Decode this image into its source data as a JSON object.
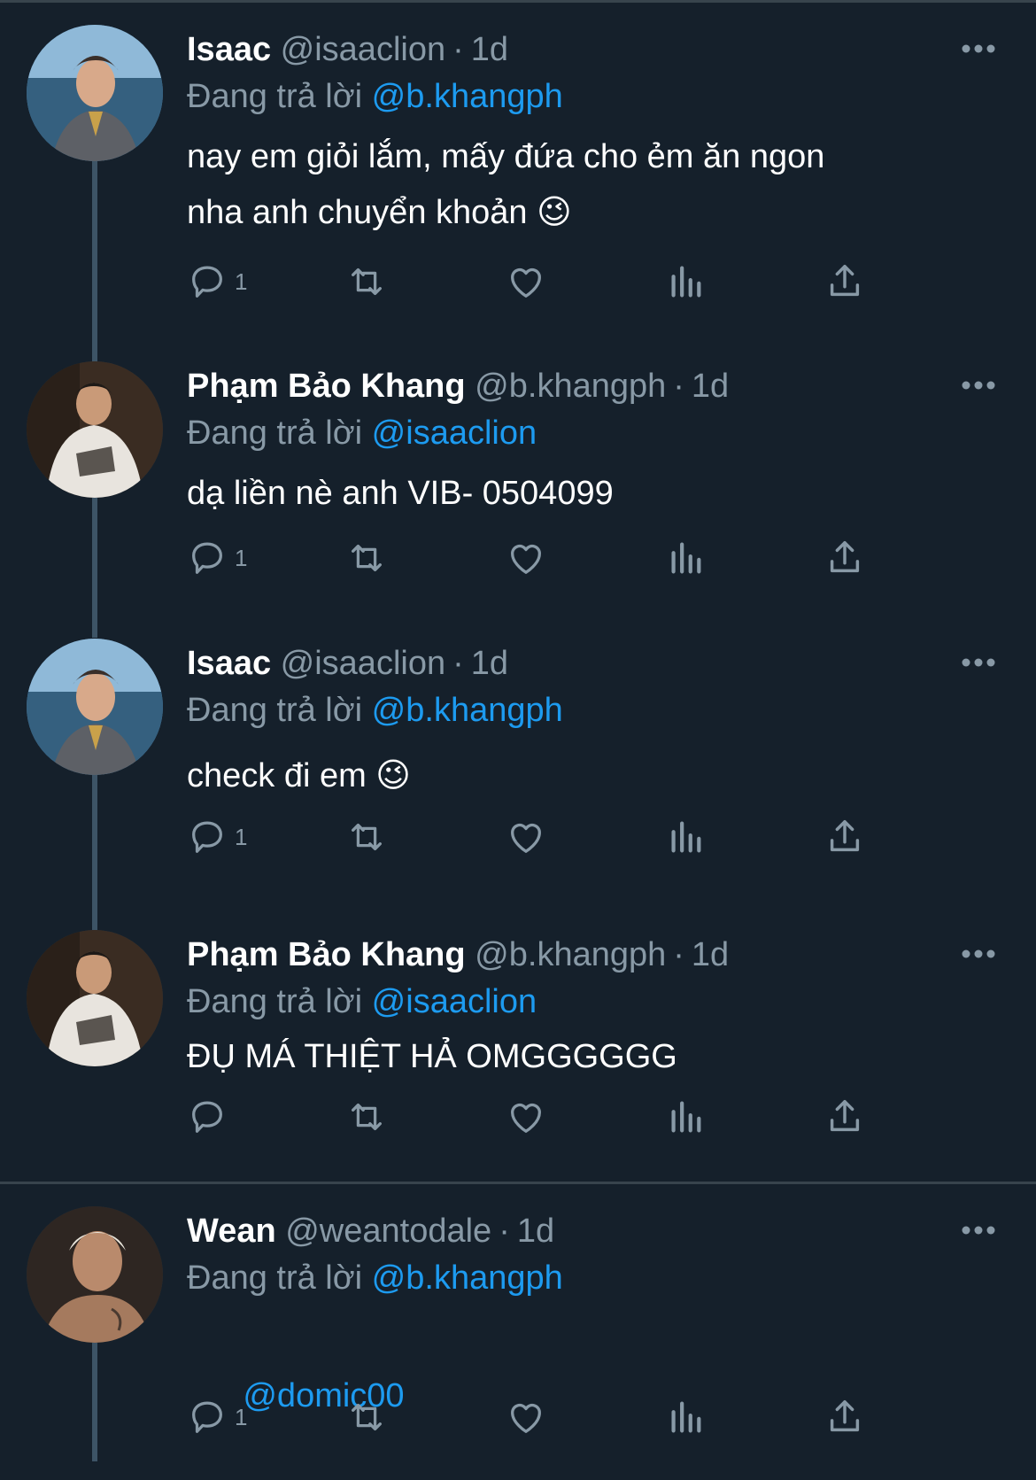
{
  "colors": {
    "background": "#15202b",
    "text": "#ffffff",
    "secondary": "#8899a6",
    "accent": "#1d9bf0",
    "thread_line": "#3d5466"
  },
  "tweets": [
    {
      "name": "Isaac",
      "handle": "@isaaclion",
      "dot": "·",
      "time": "1d",
      "reply_prefix": "Đang trả lời",
      "reply_to": "@b.khangph",
      "text": "nay em giỏi lắm, mấy đứa cho ẻm ăn ngon\nnha anh chuyển khoản 😉",
      "reply_count": "1"
    },
    {
      "name": "Phạm Bảo Khang",
      "handle": "@b.khangph",
      "dot": "·",
      "time": "1d",
      "reply_prefix": "Đang trả lời",
      "reply_to": "@isaaclion",
      "text": "dạ liền nè anh VIB- 0504099",
      "reply_count": "1"
    },
    {
      "name": "Isaac",
      "handle": "@isaaclion",
      "dot": "·",
      "time": "1d",
      "reply_prefix": "Đang trả lời",
      "reply_to": "@b.khangph",
      "text": "check đi em 😉",
      "reply_count": "1"
    },
    {
      "name": "Phạm Bảo Khang",
      "handle": "@b.khangph",
      "dot": "·",
      "time": "1d",
      "reply_prefix": "Đang trả lời",
      "reply_to": "@isaaclion",
      "text": "ĐỤ MÁ THIỆT HẢ OMGGGGGG",
      "reply_count": ""
    },
    {
      "name": "Wean",
      "handle": "@weantodale",
      "dot": "·",
      "time": "1d",
      "reply_prefix": "Đang trả lời",
      "reply_to": "@b.khangph",
      "text": "",
      "text_mention": "@domic00",
      "reply_count": "1"
    }
  ],
  "icons": {
    "reply": "reply-bubble-icon",
    "retweet": "retweet-icon",
    "like": "heart-icon",
    "views": "analytics-icon",
    "share": "share-icon",
    "more": "more-dots-icon"
  }
}
